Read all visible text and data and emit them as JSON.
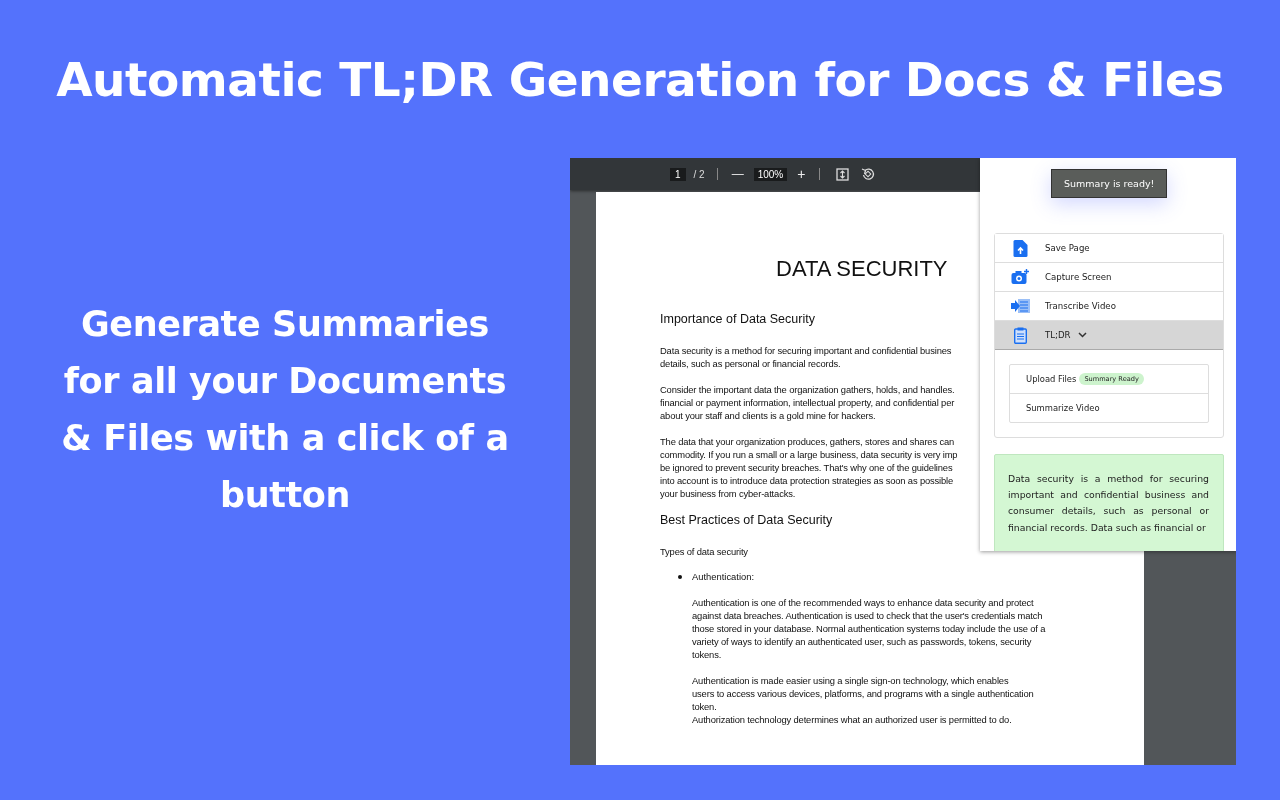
{
  "headline": "Automatic TL;DR Generation for Docs & Files",
  "tagline": "Generate Summaries for all your Documents & Files with a click of a button",
  "viewer": {
    "toolbar": {
      "page": "1",
      "page_total": "/ 2",
      "zoom_out": "—",
      "zoom": "100%",
      "zoom_in": "+"
    },
    "document": {
      "title": "DATA SECURITY",
      "blocks": [
        {
          "kind": "heading",
          "lines": [
            "Importance of Data Security"
          ]
        },
        {
          "kind": "para",
          "lines": [
            "Data security is a method for securing important and confidential busines",
            "details, such as personal or financial records."
          ]
        },
        {
          "kind": "para",
          "lines": [
            "Consider the important data the organization gathers, holds, and handles.",
            "financial or payment information, intellectual property, and confidential per",
            "about your staff and clients is a gold mine for hackers."
          ]
        },
        {
          "kind": "para",
          "lines": [
            "The data that your organization produces, gathers, stores and shares can",
            "commodity. If you run a small or a large business, data security is very imp",
            "be ignored to prevent security breaches. That's why one of the guidelines",
            "into account is to introduce data protection strategies as soon as possible",
            "your business from cyber-attacks."
          ]
        },
        {
          "kind": "heading",
          "lines": [
            "Best Practices of Data Security"
          ]
        },
        {
          "kind": "para",
          "lines": [
            "Types of data security"
          ]
        },
        {
          "kind": "bullet",
          "lines": [
            "Authentication:"
          ]
        },
        {
          "kind": "indent",
          "lines": [
            "Authentication is one of the recommended ways to enhance data security and protect",
            "against data breaches. Authentication is used to check that the user's credentials match",
            "those stored in your database. Normal authentication systems today include the use of a",
            "variety of ways to identify an authenticated user, such as passwords, tokens, security",
            "tokens."
          ]
        },
        {
          "kind": "indent",
          "lines": [
            "Authentication is made easier using a single sign-on technology, which enables",
            "users to access various devices, platforms, and programs with a single authentication",
            "token.",
            "Authorization technology determines what an authorized user is permitted to do."
          ]
        }
      ]
    }
  },
  "popup": {
    "toast": "Summary is ready!",
    "menu": [
      {
        "kind": "save",
        "label": "Save Page",
        "selected": false
      },
      {
        "kind": "camera",
        "label": "Capture Screen",
        "selected": false
      },
      {
        "kind": "transcribe",
        "label": "Transcribe Video",
        "selected": false
      },
      {
        "kind": "clipboard",
        "label": "TL;DR",
        "selected": true,
        "expanded": true
      }
    ],
    "submenu": [
      {
        "label": "Upload Files",
        "badge": "Summary Ready"
      },
      {
        "label": "Summarize Video"
      }
    ],
    "summary": "Data security is a method for securing important and confidential business and consumer details, such as personal or financial records. Data such as financial or"
  }
}
